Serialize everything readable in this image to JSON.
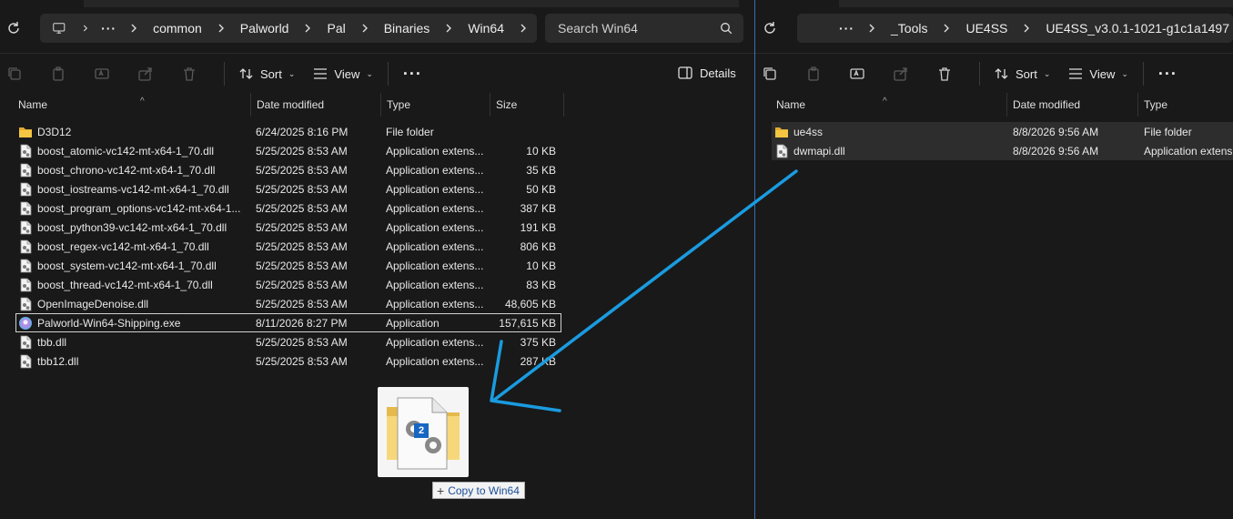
{
  "left": {
    "breadcrumb": [
      "common",
      "Palworld",
      "Pal",
      "Binaries",
      "Win64"
    ],
    "search_placeholder": "Search Win64",
    "toolbar": {
      "sort": "Sort",
      "view": "View",
      "details": "Details"
    },
    "columns": {
      "name": "Name",
      "date": "Date modified",
      "type": "Type",
      "size": "Size"
    },
    "files": [
      {
        "name": "D3D12",
        "date": "6/24/2025 8:16 PM",
        "type": "File folder",
        "size": "",
        "icon": "folder-icon"
      },
      {
        "name": "boost_atomic-vc142-mt-x64-1_70.dll",
        "date": "5/25/2025 8:53 AM",
        "type": "Application extens...",
        "size": "10 KB",
        "icon": "dll-file-icon"
      },
      {
        "name": "boost_chrono-vc142-mt-x64-1_70.dll",
        "date": "5/25/2025 8:53 AM",
        "type": "Application extens...",
        "size": "35 KB",
        "icon": "dll-file-icon"
      },
      {
        "name": "boost_iostreams-vc142-mt-x64-1_70.dll",
        "date": "5/25/2025 8:53 AM",
        "type": "Application extens...",
        "size": "50 KB",
        "icon": "dll-file-icon"
      },
      {
        "name": "boost_program_options-vc142-mt-x64-1...",
        "date": "5/25/2025 8:53 AM",
        "type": "Application extens...",
        "size": "387 KB",
        "icon": "dll-file-icon"
      },
      {
        "name": "boost_python39-vc142-mt-x64-1_70.dll",
        "date": "5/25/2025 8:53 AM",
        "type": "Application extens...",
        "size": "191 KB",
        "icon": "dll-file-icon"
      },
      {
        "name": "boost_regex-vc142-mt-x64-1_70.dll",
        "date": "5/25/2025 8:53 AM",
        "type": "Application extens...",
        "size": "806 KB",
        "icon": "dll-file-icon"
      },
      {
        "name": "boost_system-vc142-mt-x64-1_70.dll",
        "date": "5/25/2025 8:53 AM",
        "type": "Application extens...",
        "size": "10 KB",
        "icon": "dll-file-icon"
      },
      {
        "name": "boost_thread-vc142-mt-x64-1_70.dll",
        "date": "5/25/2025 8:53 AM",
        "type": "Application extens...",
        "size": "83 KB",
        "icon": "dll-file-icon"
      },
      {
        "name": "OpenImageDenoise.dll",
        "date": "5/25/2025 8:53 AM",
        "type": "Application extens...",
        "size": "48,605 KB",
        "icon": "dll-file-icon"
      },
      {
        "name": "Palworld-Win64-Shipping.exe",
        "date": "8/11/2026 8:27 PM",
        "type": "Application",
        "size": "157,615 KB",
        "icon": "palworld-exe-icon",
        "selected": true
      },
      {
        "name": "tbb.dll",
        "date": "5/25/2025 8:53 AM",
        "type": "Application extens...",
        "size": "375 KB",
        "icon": "dll-file-icon"
      },
      {
        "name": "tbb12.dll",
        "date": "5/25/2025 8:53 AM",
        "type": "Application extens...",
        "size": "287 KB",
        "icon": "dll-file-icon"
      }
    ]
  },
  "right": {
    "breadcrumb": [
      "_Tools",
      "UE4SS",
      "UE4SS_v3.0.1-1021-g1c1a1497"
    ],
    "toolbar": {
      "sort": "Sort",
      "view": "View"
    },
    "columns": {
      "name": "Name",
      "date": "Date modified",
      "type": "Type"
    },
    "files": [
      {
        "name": "ue4ss",
        "date": "8/8/2026 9:56 AM",
        "type": "File folder",
        "icon": "folder-icon"
      },
      {
        "name": "dwmapi.dll",
        "date": "8/8/2026 9:56 AM",
        "type": "Application extens",
        "icon": "dll-file-icon"
      }
    ]
  },
  "drag": {
    "count": "2",
    "tooltip": "Copy to Win64"
  },
  "colors": {
    "annotation_arrow": "#1a9be0",
    "folder": "#f4c542",
    "selection_border": "#d0d0d0"
  }
}
